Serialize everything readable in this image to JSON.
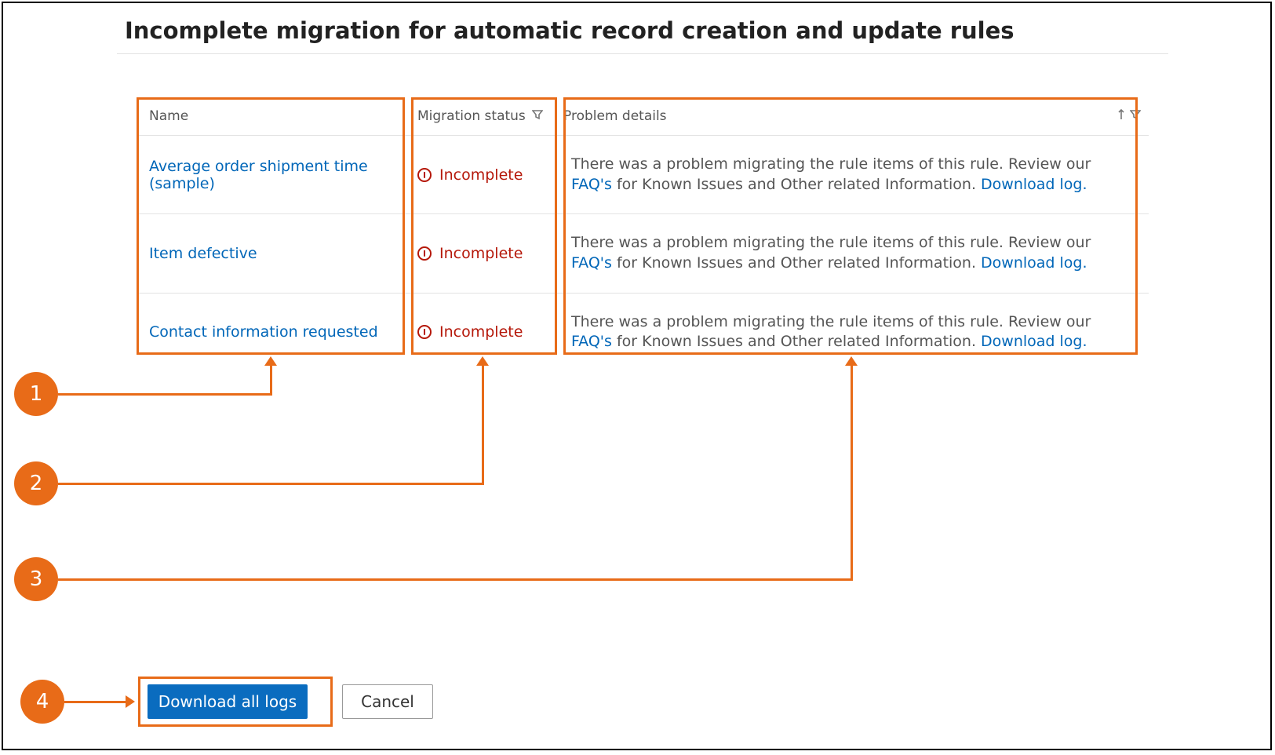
{
  "page": {
    "title": "Incomplete migration for automatic record creation and update rules"
  },
  "columns": {
    "name": "Name",
    "status": "Migration status",
    "details": "Problem details"
  },
  "rows": [
    {
      "name": "Average order shipment time (sample)",
      "status": "Incomplete",
      "detail_pre": "There was a problem migrating the rule items of this rule. Review our ",
      "faq_link": "FAQ's",
      "detail_mid": " for Known Issues and Other related Information. ",
      "log_link": "Download log."
    },
    {
      "name": "Item defective",
      "status": "Incomplete",
      "detail_pre": "There was a problem migrating the rule items of this rule. Review our ",
      "faq_link": "FAQ's",
      "detail_mid": " for Known Issues and Other related Information. ",
      "log_link": "Download log."
    },
    {
      "name": "Contact information requested",
      "status": "Incomplete",
      "detail_pre": "There was a problem migrating the rule items of this rule. Review our ",
      "faq_link": "FAQ's",
      "detail_mid": " for Known Issues and Other related Information. ",
      "log_link": "Download log."
    }
  ],
  "buttons": {
    "download_all": "Download all logs",
    "cancel": "Cancel"
  },
  "callouts": {
    "c1": "1",
    "c2": "2",
    "c3": "3",
    "c4": "4"
  }
}
